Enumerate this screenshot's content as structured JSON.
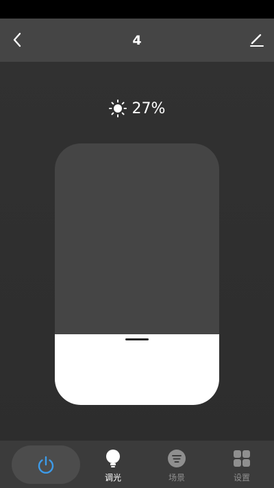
{
  "header": {
    "title": "4",
    "back_icon": "chevron-left-icon",
    "edit_icon": "pencil-icon"
  },
  "brightness": {
    "icon": "sun-icon",
    "value_label": "27%",
    "level_percent": 27
  },
  "bottom_nav": {
    "power_icon": "power-icon",
    "accent_color": "#3d9be9",
    "items": [
      {
        "label": "调光",
        "icon": "bulb-icon",
        "active": true
      },
      {
        "label": "场景",
        "icon": "scene-icon",
        "active": false
      },
      {
        "label": "设置",
        "icon": "grid-icon",
        "active": false
      }
    ]
  }
}
